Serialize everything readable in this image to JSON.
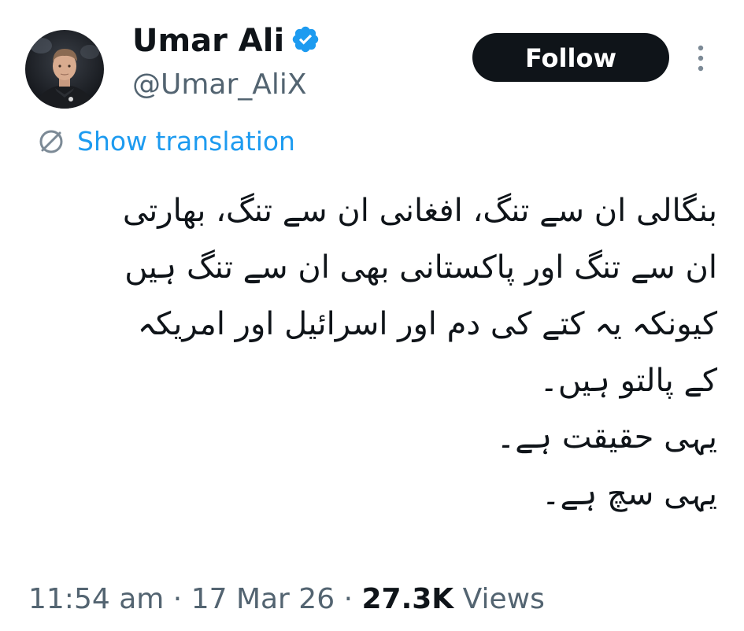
{
  "author": {
    "display_name": "Umar Ali",
    "handle": "@Umar_AliX",
    "verified": true
  },
  "follow_label": "Follow",
  "translation_label": "Show translation",
  "tweet_lines": [
    "بنگالی ان سے تنگ، افغانی ان سے تنگ، بھارتی",
    "ان سے تنگ اور پاکستانی بھی ان سے تنگ ہیں",
    "کیونکہ یہ کتے کی دم اور اسرائیل اور امریکہ",
    "کے پالتو ہیں۔",
    "یہی حقیقت ہے۔",
    "یہی سچ ہے۔"
  ],
  "meta": {
    "time": "11:54 am",
    "sep1": "·",
    "date": "17 Mar 26",
    "sep2": "·",
    "views_count": "27.3K",
    "views_label": "Views"
  },
  "colors": {
    "text": "#0f1419",
    "secondary": "#536471",
    "accent": "#1d9bf0",
    "button_bg": "#0f1419"
  },
  "icons": {
    "verified": "verified-badge-icon",
    "more": "more-vertical-icon",
    "translate": "translate-globe-icon"
  }
}
